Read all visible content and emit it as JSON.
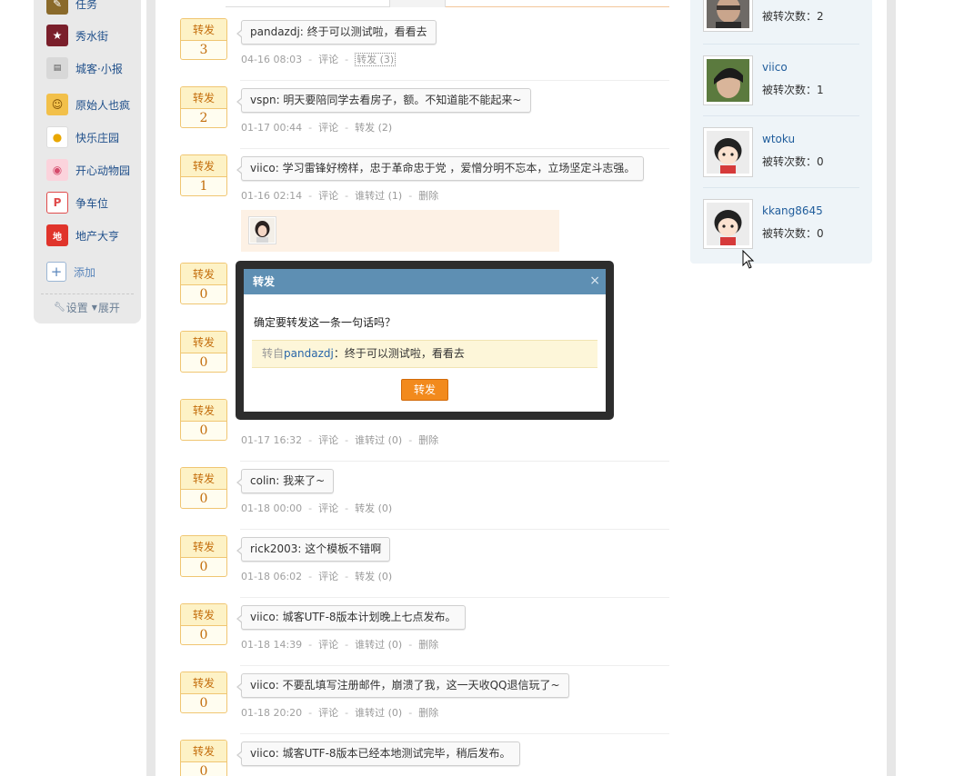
{
  "sidebar": {
    "apps": [
      {
        "label": "任务"
      },
      {
        "label": "秀水街"
      },
      {
        "label": "城客·小报"
      },
      {
        "label": "原始人也疯"
      },
      {
        "label": "快乐庄园"
      },
      {
        "label": "开心动物园"
      },
      {
        "label": "争车位"
      },
      {
        "label": "地产大亨"
      }
    ],
    "add_label": "添加",
    "settings_label": "设置",
    "expand_label": "展开"
  },
  "feed": {
    "repost_label": "转发",
    "comment_label": "评论",
    "who_reposted_label": "谁转过",
    "delete_label": "删除",
    "items": [
      {
        "count": "3",
        "text": "pandazdj: 终于可以测试啦，看看去",
        "time": "04-16 08:03",
        "second": "转发 (3)"
      },
      {
        "count": "2",
        "text": "vspn: 明天要陪同学去看房子，额。不知道能不能起来~",
        "time": "01-17 00:44",
        "second": "转发 (2)"
      },
      {
        "count": "1",
        "text": "viico: 学习雷锋好榜样，忠于革命忠于党 ，爱憎分明不忘本，立场坚定斗志强。",
        "time": "01-16 02:14",
        "second": "谁转过 (1)"
      },
      {
        "count": "0"
      },
      {
        "count": "0"
      },
      {
        "count": "0",
        "time": "01-17 16:32",
        "second": "谁转过 (0)"
      },
      {
        "count": "0",
        "text": "colin: 我来了~",
        "time": "01-18 00:00",
        "second": "转发 (0)"
      },
      {
        "count": "0",
        "text": "rick2003: 这个模板不错啊",
        "time": "01-18 06:02",
        "second": "转发 (0)"
      },
      {
        "count": "0",
        "text": "viico: 城客UTF-8版本计划晚上七点发布。",
        "time": "01-18 14:39",
        "second": "谁转过 (0)"
      },
      {
        "count": "0",
        "text": "viico: 不要乱填写注册邮件，崩溃了我，这一天收QQ退信玩了~",
        "time": "01-18 20:20",
        "second": "谁转过 (0)"
      },
      {
        "count": "0",
        "text": "viico: 城客UTF-8版本已经本地测试完毕，稍后发布。"
      }
    ]
  },
  "users": [
    {
      "name": "",
      "count_text": "被转次数：2"
    },
    {
      "name": "viico",
      "count_text": "被转次数：1"
    },
    {
      "name": "wtoku",
      "count_text": "被转次数：0"
    },
    {
      "name": "kkang8645",
      "count_text": "被转次数：0"
    }
  ],
  "modal": {
    "title": "转发",
    "close": "×",
    "question": "确定要转发这一条一句话吗？",
    "quote_prefix": "转自",
    "quote_user": "pandazdj",
    "quote_text": "：终于可以测试啦，看看去",
    "button": "转发"
  },
  "colors": {
    "modal_header": "#5e8fb3",
    "modal_button": "#f28a1d",
    "badge_text": "#c36d0b",
    "link": "#1f5c9b"
  }
}
